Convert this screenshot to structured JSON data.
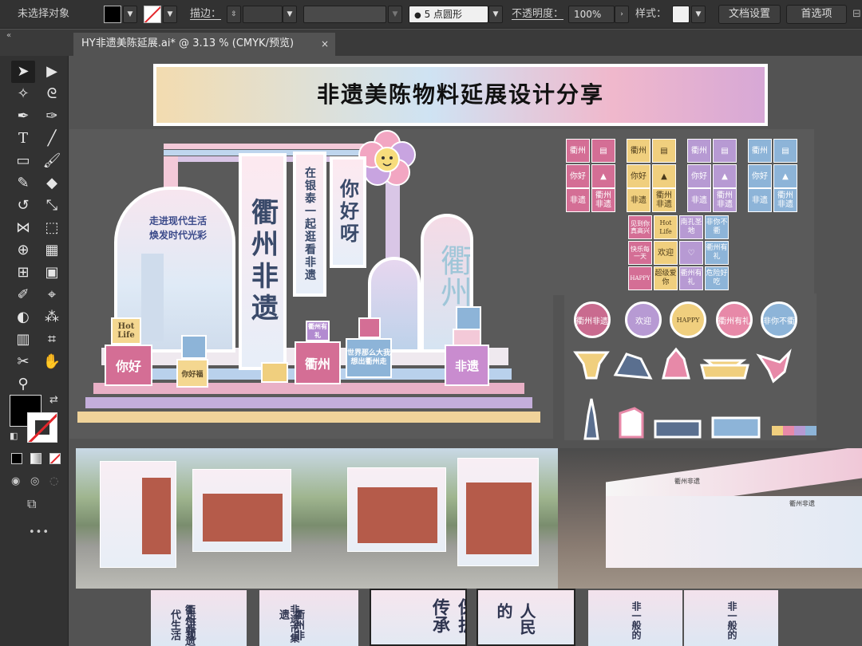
{
  "control_bar": {
    "selection": "未选择对象",
    "stroke_label": "描边：",
    "brush_value": "5 点圆形",
    "opacity_label": "不透明度：",
    "opacity_value": "100%",
    "style_label": "样式：",
    "doc_setup": "文档设置",
    "preferences": "首选项"
  },
  "tab": {
    "title": "HY非遗美陈延展.ai* @ 3.13 % (CMYK/预览)",
    "close": "×"
  },
  "toolbar": {
    "tools": [
      "selection",
      "direct-selection",
      "magic-wand",
      "lasso",
      "pen",
      "curvature",
      "type",
      "line",
      "rectangle",
      "paintbrush",
      "shaper",
      "eraser",
      "rotate",
      "scale",
      "width",
      "free-transform",
      "shape-builder",
      "perspective-grid",
      "mesh",
      "gradient",
      "eyedropper",
      "measure",
      "blend",
      "symbol-sprayer",
      "column-graph",
      "artboard",
      "slice",
      "hand",
      "zoom"
    ],
    "more": "•••"
  },
  "canvas": {
    "title": "非遗美陈物料延展设计分享",
    "stage": {
      "arch_text_1": "走进现代生活",
      "arch_text_2": "焕发时代光彩",
      "banner_1": "衢州非遗",
      "banner_2": "在银泰一起逛看非遗",
      "banner_3": "你好呀",
      "box_hello": "你好",
      "box_hot": "Hot Life",
      "box_quzhou": "衢州",
      "box_youli": "衢州有礼",
      "box_feiyi": "非遗",
      "box_world": "世界那么大我想出衢州走",
      "box_hui": "你好福",
      "box_heritage": "非遗"
    },
    "stickers": {
      "group_a": [
        "衢州",
        "",
        "你好",
        "",
        "非遗",
        "衢州非遗"
      ],
      "group_b": [
        "衢州",
        "",
        "你好",
        "",
        "非遗",
        "衢州非遗"
      ],
      "group_c": [
        "衢州",
        "",
        "你好",
        "",
        "非遗",
        "衢州非遗"
      ],
      "group_d": [
        "衢州",
        "",
        "你好",
        "",
        "非遗",
        "衢州非遗"
      ],
      "grid": [
        "见到你真高兴",
        "Hot Life",
        "南孔圣地",
        "非你不衢",
        "快乐每一天",
        "欢迎",
        "",
        "衢州有礼",
        "HAPPY",
        "超级爱你",
        "衢州有礼",
        "危险好吃"
      ]
    },
    "flowers": [
      "衢州非遗",
      "欢迎",
      "HAPPY",
      "衢州有礼",
      "非你不衢"
    ],
    "photo_right": {
      "stall_header_1": "衢州非遗",
      "stall_header_2": "衢州非遗"
    },
    "posters": [
      "走进现代生活",
      "衢州非遗",
      "非遗市集",
      "衢州非遗",
      "保护传承",
      "人民的",
      "非一般的",
      "非一般的"
    ]
  },
  "colors": {
    "pink": "#e789a8",
    "lavender": "#b79ad3",
    "blue": "#8db4d8",
    "yellow": "#f0cf7e",
    "rose": "#c96b8f"
  }
}
